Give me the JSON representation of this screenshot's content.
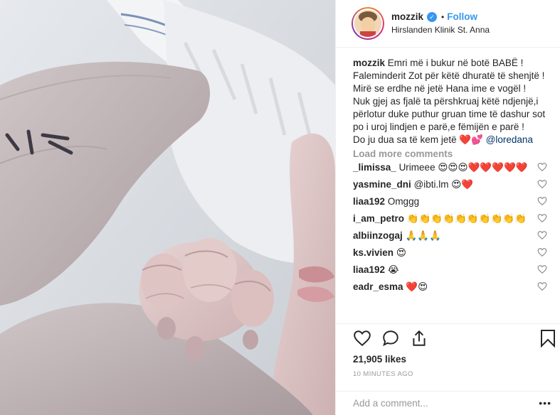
{
  "header": {
    "username": "mozzik",
    "verified_icon": "verified-badge-icon",
    "separator": "•",
    "follow_label": "Follow",
    "location": "Hirslanden Klinik St. Anna"
  },
  "caption": {
    "username": "mozzik",
    "text": "Emri më i bukur në botë BABË !\nFaleminderit Zot për këtë dhuratë të shenjtë !\nMirë se erdhe në jetë Hana ime e vogël !\nNuk gjej as fjalë ta përshkruaj këtë ndjenjë,i përlotur duke puthur gruan time të dashur sot po i uroj lindjen e parë,e fëmijën e parë !\nDo ju dua sa të kem jetë ❤️💕 ",
    "mention": "@loredana"
  },
  "load_more_label": "Load more comments",
  "comments": [
    {
      "user": "_limissa_",
      "text": "Urimeee 😍😍😍❤️❤️❤️❤️❤️"
    },
    {
      "user": "yasmine_dni",
      "text": "@ibti.lm 😍❤️"
    },
    {
      "user": "liaa192",
      "text": "Omggg"
    },
    {
      "user": "i_am_petro",
      "text": "👏👏👏👏👏👏👏👏👏👏"
    },
    {
      "user": "albiinzogaj",
      "text": "🙏🙏🙏"
    },
    {
      "user": "ks.vivien",
      "text": "😍"
    },
    {
      "user": "liaa192",
      "text": "😭"
    },
    {
      "user": "eadr_esma",
      "text": "❤️😍"
    }
  ],
  "likes": "21,905 likes",
  "timestamp": "10 MINUTES AGO",
  "add_comment_placeholder": "Add a comment...",
  "more_label": "•••",
  "colors": {
    "accent": "#3897f0",
    "muted": "#999999",
    "text": "#262626",
    "border": "#efefef"
  },
  "icons": [
    "heart-icon",
    "comment-icon",
    "share-icon",
    "bookmark-icon",
    "options-icon"
  ]
}
